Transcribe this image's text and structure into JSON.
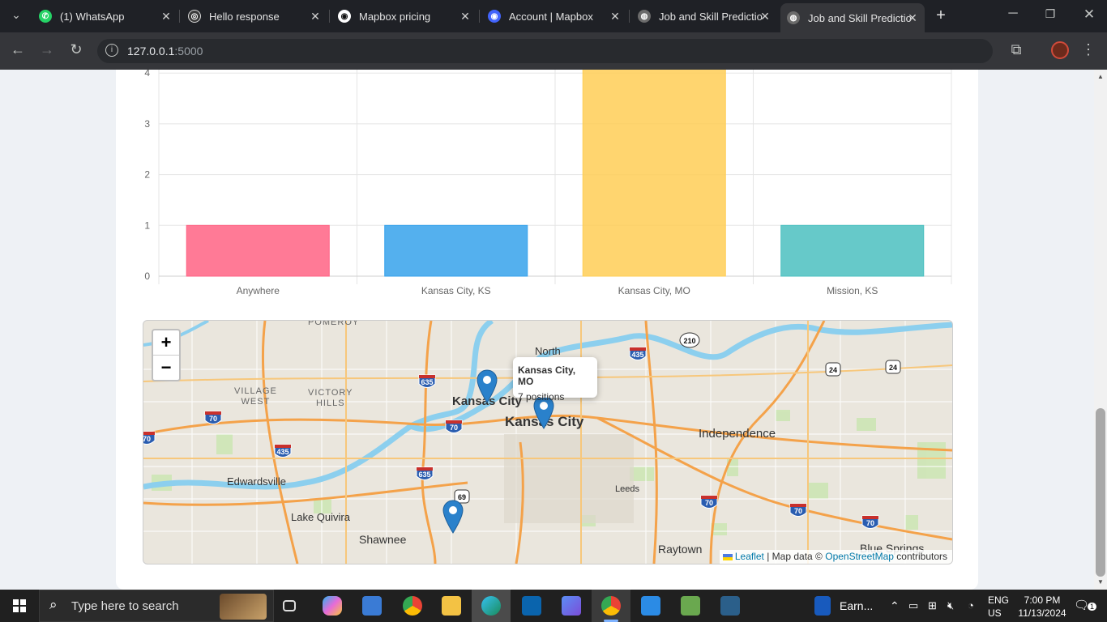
{
  "browser": {
    "tabs": [
      {
        "title": "(1) WhatsApp",
        "icon": "whatsapp-icon",
        "color": "#25d366"
      },
      {
        "title": "Hello response",
        "icon": "chatgpt-icon",
        "color": "#d9d9d9"
      },
      {
        "title": "Mapbox pricing",
        "icon": "mapbox-icon",
        "color": "#111111"
      },
      {
        "title": "Account | Mapbox",
        "icon": "mapbox-account-icon",
        "color": "#4264fb"
      },
      {
        "title": "Job and Skill Predictio",
        "icon": "globe-icon",
        "color": "#8a8a8a"
      },
      {
        "title": "Job and Skill Predictio",
        "icon": "globe-icon",
        "color": "#8a8a8a"
      }
    ],
    "url_host": "127.0.0.1",
    "url_port": ":5000"
  },
  "chart_data": {
    "type": "bar",
    "categories": [
      "Anywhere",
      "Kansas City, KS",
      "Kansas City, MO",
      "Mission, KS"
    ],
    "values": [
      1,
      1,
      7,
      1
    ],
    "colors": [
      "#ff6384",
      "#36a2eb",
      "#ffce56",
      "#4bc0c0"
    ],
    "y_ticks": [
      "0",
      "1",
      "2",
      "3",
      "4"
    ],
    "ylim": [
      0,
      7
    ],
    "grid": true
  },
  "map": {
    "zoom_in": "+",
    "zoom_out": "−",
    "popup_title": "Kansas City, MO",
    "popup_text": "7 positions",
    "labels": {
      "north": "North",
      "kc_left": "Kansas City",
      "kc_main": "Kansas City",
      "independence": "Independence",
      "village_west_1": "VILLAGE",
      "village_west_2": "WEST",
      "victory_hills_1": "VICTORY",
      "victory_hills_2": "HILLS",
      "edwardsville": "Edwardsville",
      "lake_quivira": "Lake Quivira",
      "shawnee": "Shawnee",
      "leeds": "Leeds",
      "raytown": "Raytown",
      "blue_springs": "Blue Springs",
      "pomeroy": "POMEROY"
    },
    "shields": {
      "i635a": "635",
      "i435a": "435",
      "i70a": "70",
      "i70b": "70",
      "i70c": "70",
      "i435b": "435",
      "i635b": "635",
      "i70d": "70",
      "i70e": "70",
      "i70f": "70",
      "us69": "69",
      "us24a": "24",
      "us24b": "24",
      "r210": "210"
    },
    "attribution": {
      "leaflet": "Leaflet",
      "sep": "| Map data ©",
      "osm": "OpenStreetMap",
      "contrib": "contributors"
    }
  },
  "taskbar": {
    "search_placeholder": "Type here to search",
    "pinned_label": "Earn...",
    "lang": "ENG",
    "region": "US",
    "time": "7:00 PM",
    "date": "11/13/2024",
    "notif_count": "1"
  }
}
